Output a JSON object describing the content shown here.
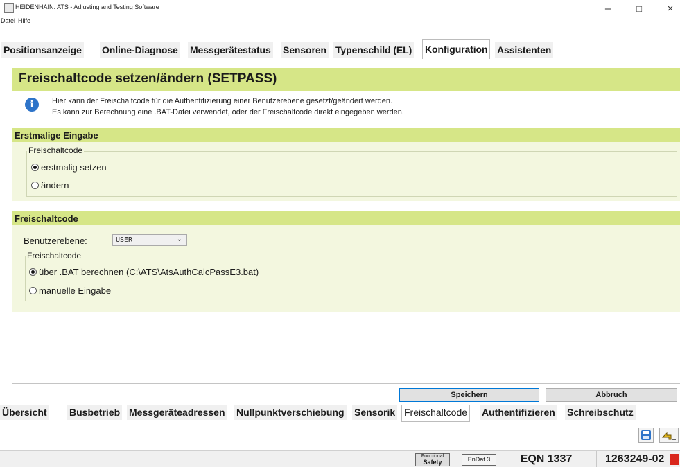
{
  "window": {
    "title": "HEIDENHAIN: ATS - Adjusting and Testing Software",
    "minimize": "–",
    "maximize": "□",
    "close": "×"
  },
  "menu": [
    "Datei",
    "Hilfe"
  ],
  "top_tabs": [
    "Positionsanzeige",
    "Online-Diagnose",
    "Messgerätestatus",
    "Sensoren",
    "Typenschild (EL)",
    "Konfiguration",
    "Assistenten"
  ],
  "active_top_tab": "Konfiguration",
  "heading": "Freischaltcode setzen/ändern (SETPASS)",
  "info": {
    "icon": "info-icon",
    "line1": "Hier kann der Freischaltcode für die Authentifizierung einer Benutzerebene gesetzt/geändert werden.",
    "line2": "Es kann zur Berechnung eine .BAT-Datei verwendet, oder der Freischaltcode direkt eingegeben werden."
  },
  "section1": {
    "title": "Erstmalige Eingabe",
    "group_label": "Freischaltcode",
    "options": [
      "erstmalig setzen",
      "ändern"
    ],
    "selected": "erstmalig setzen"
  },
  "section2": {
    "title": "Freischaltcode",
    "level_label": "Benutzerebene:",
    "level_value": "USER",
    "group_label": "Freischaltcode",
    "options": [
      "über .BAT berechnen (C:\\ATS\\AtsAuthCalcPassE3.bat)",
      "manuelle Eingabe"
    ],
    "selected": "über .BAT berechnen (C:\\ATS\\AtsAuthCalcPassE3.bat)"
  },
  "buttons": {
    "save": "Speichern",
    "cancel": "Abbruch"
  },
  "bottom_tabs": [
    "Übersicht",
    "Busbetrieb",
    "Messgeräteadressen",
    "Nullpunktverschiebung",
    "Sensorik",
    "Freischaltcode",
    "Authentifizieren",
    "Schreibschutz"
  ],
  "active_bottom_tab": "Freischaltcode",
  "toolbar_icons": [
    "save-disk-icon",
    "return-arrow-icon"
  ],
  "status": {
    "badge1_line1": "Functional",
    "badge1_line2": "Safety",
    "badge2": "EnDat 3",
    "device": "EQN 1337",
    "serial": "1263249-02"
  },
  "colors": {
    "accent": "#d6e687",
    "panel": "#f3f7df",
    "info_icon": "#2e74c9"
  }
}
